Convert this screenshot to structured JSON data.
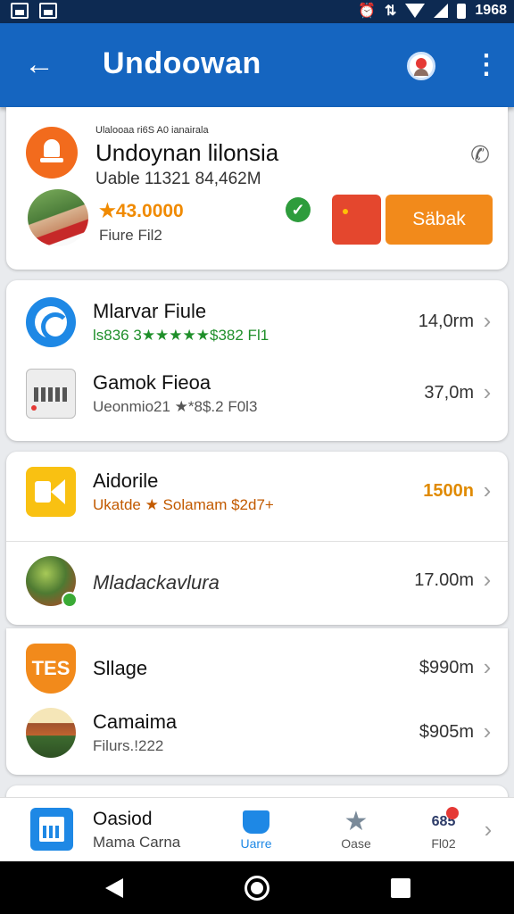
{
  "status_bar": {
    "time": "1968",
    "alarm": "⏰",
    "data": "⇅"
  },
  "app_bar": {
    "title": "Undoowan"
  },
  "profile": {
    "caption": "Ulalooaa ri6S A0 ianairala",
    "name": "Undoynan lilonsia",
    "subtitle": "Uable 11321 84,462M",
    "rating": "★43.0000",
    "subtitle2": "Fiure Fil2",
    "button_label": "Säbak"
  },
  "list_group_1": [
    {
      "name": "Mlarvar Fiule",
      "meta": "ls836 3★★★★★$382 Fl1",
      "meta_color": "#1f8f2a",
      "value": "14,0rm",
      "value_color": "#333333",
      "icon": "timer-icon"
    },
    {
      "name": "Gamok Fieoa",
      "meta": "Ueonmio21 ★*8$.2 F0l3",
      "meta_color": "#555555",
      "value": "37,0m",
      "value_color": "#333333",
      "icon": "keyboard-icon"
    }
  ],
  "list_group_2": [
    {
      "name": "Aidorile",
      "meta": "Ukatde ★ Solamam $2d7+",
      "meta_color": "#c25a00",
      "value": "1500n",
      "value_color": "#e08a00",
      "icon": "video-icon"
    },
    {
      "name": "Mladackavlura",
      "meta": "",
      "meta_color": "#555555",
      "value": "17.00m",
      "value_color": "#333333",
      "icon": "nature-icon"
    }
  ],
  "list_group_3": [
    {
      "name": "Sllage",
      "meta": "",
      "meta_color": "#555555",
      "value": "$990m",
      "value_color": "#222222",
      "icon": "tes-icon",
      "icon_text": "TES"
    },
    {
      "name": "Camaima",
      "meta": "Filurs.!222",
      "meta_color": "#555555",
      "value": "$905m",
      "value_color": "#222222",
      "icon": "house-icon"
    }
  ],
  "bottom_nav": {
    "title": "Oasiod",
    "subtitle": "Mama Carna",
    "tabs": [
      {
        "label": "Uarre",
        "icon": "book-icon",
        "active": true
      },
      {
        "label": "Oase",
        "icon": "star-icon",
        "active": false
      },
      {
        "label": "Fl02",
        "icon": "badge-icon",
        "active": false,
        "icon_text": "685"
      }
    ]
  },
  "colors": {
    "app_bar": "#1565c0",
    "accent_orange": "#f28a1b",
    "status_bar": "#0d2a52"
  }
}
